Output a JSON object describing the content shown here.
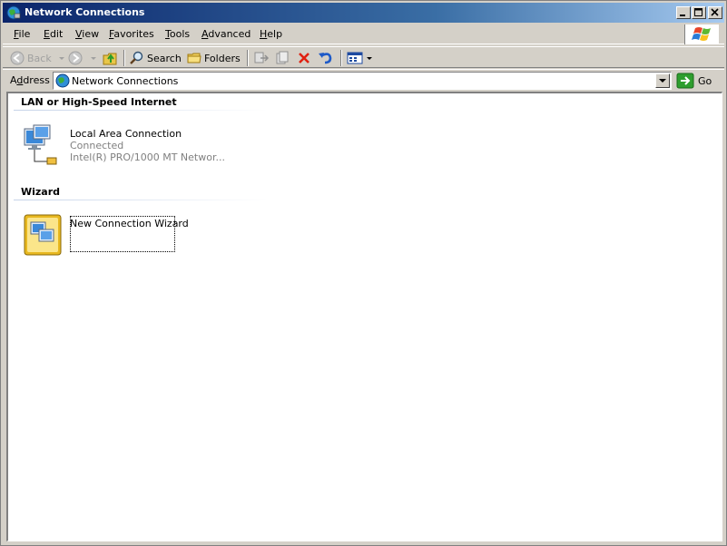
{
  "window": {
    "title": "Network Connections"
  },
  "menu": {
    "items": [
      {
        "label": "File",
        "ul": "F",
        "rest": "ile"
      },
      {
        "label": "Edit",
        "ul": "E",
        "rest": "dit"
      },
      {
        "label": "View",
        "ul": "V",
        "rest": "iew"
      },
      {
        "label": "Favorites",
        "ul": "F",
        "rest": "avorites"
      },
      {
        "label": "Tools",
        "ul": "T",
        "rest": "ools"
      },
      {
        "label": "Advanced",
        "ul": "A",
        "rest": "dvanced"
      },
      {
        "label": "Help",
        "ul": "H",
        "rest": "elp"
      }
    ]
  },
  "toolbar": {
    "back_label": "Back",
    "search_label": "Search",
    "folders_label": "Folders"
  },
  "address": {
    "label_prefix": "A",
    "label_ul": "d",
    "label_rest": "dress",
    "value": "Network Connections",
    "go_label": "Go"
  },
  "groups": {
    "lan": {
      "header": "LAN or High-Speed Internet",
      "item": {
        "name": "Local Area Connection",
        "status": "Connected",
        "device": "Intel(R) PRO/1000 MT Networ..."
      }
    },
    "wizard": {
      "header": "Wizard",
      "item": {
        "name": "New Connection Wizard"
      }
    }
  },
  "colors": {
    "titlebar_start": "#0a246a",
    "titlebar_end": "#a6caf0",
    "chrome": "#d4d0c8"
  }
}
